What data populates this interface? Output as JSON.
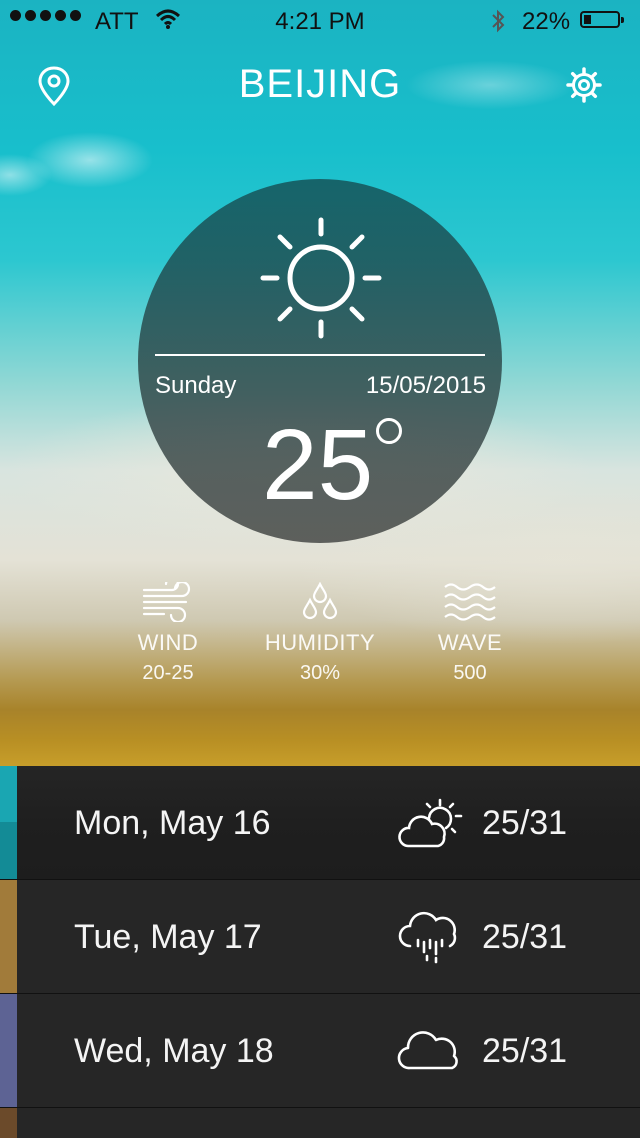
{
  "status_bar": {
    "carrier": "ATT",
    "time": "4:21 PM",
    "battery": "22%",
    "battery_level": 0.22
  },
  "header": {
    "city": "BEIJING",
    "location_icon": "map-pin-icon",
    "settings_icon": "gear-icon"
  },
  "current": {
    "icon": "sun-icon",
    "day": "Sunday",
    "date": "15/05/2015",
    "temperature": "25"
  },
  "stats": [
    {
      "icon": "wind-icon",
      "label": "WIND",
      "value": "20-25"
    },
    {
      "icon": "raindrops-icon",
      "label": "HUMIDITY",
      "value": "30%"
    },
    {
      "icon": "waves-icon",
      "label": "WAVE",
      "value": "500"
    }
  ],
  "forecast": [
    {
      "date": "Mon, May 16",
      "icon": "partly-sunny-icon",
      "range": "25/31",
      "color": "#1aa6b2"
    },
    {
      "date": "Tue, May 17",
      "icon": "rain-cloud-icon",
      "range": "25/31",
      "color": "#a17b3a"
    },
    {
      "date": "Wed, May 18",
      "icon": "cloud-icon",
      "range": "25/31",
      "color": "#5d6394"
    }
  ]
}
